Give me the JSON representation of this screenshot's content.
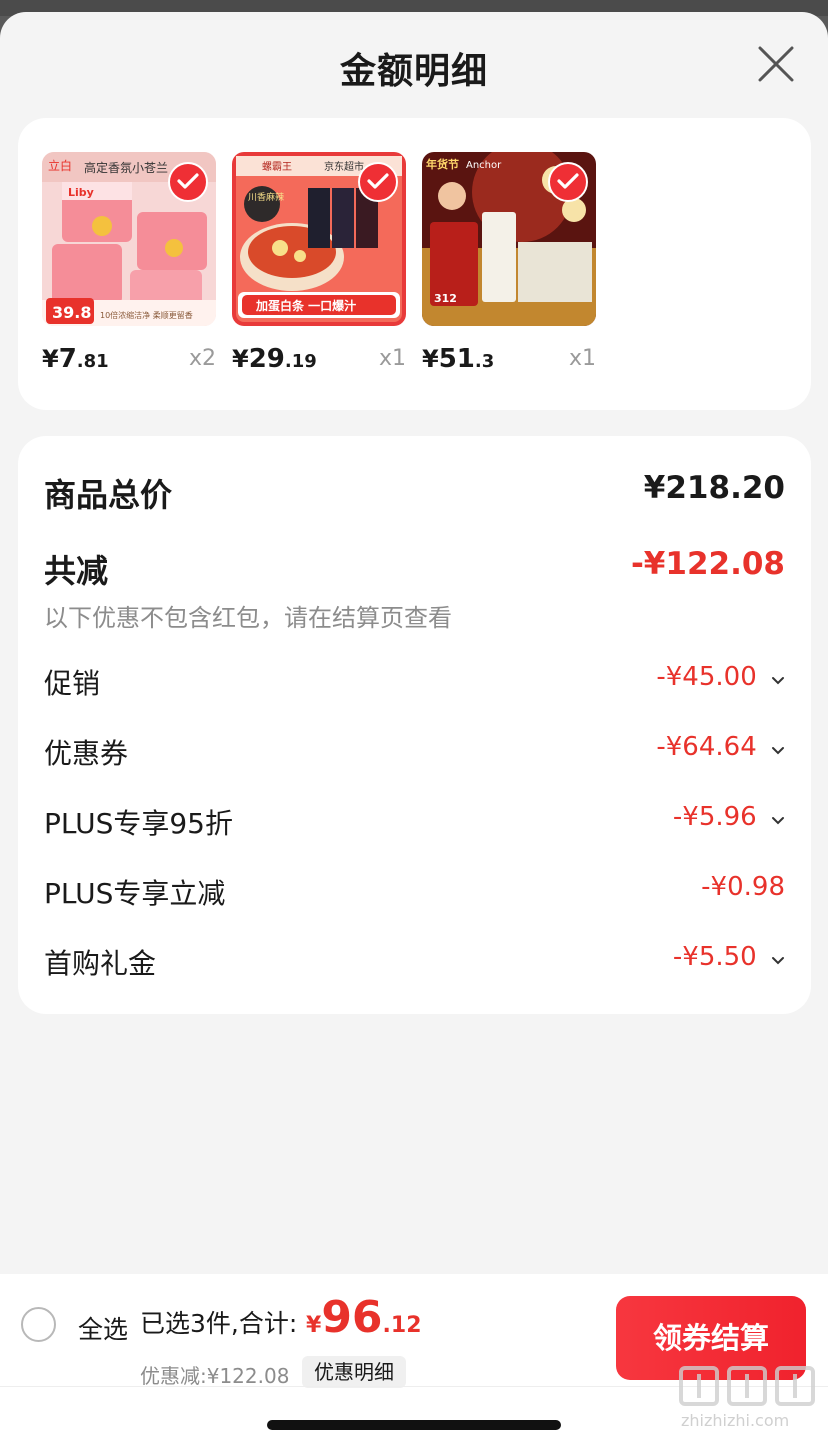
{
  "header": {
    "title": "金额明细",
    "close_icon": "close-icon"
  },
  "products": [
    {
      "name": "product-liby",
      "price_symbol": "¥",
      "price_int": "7",
      "price_dec": ".81",
      "qty": "x2",
      "thumb": {
        "banner": "高定香氛小苍兰",
        "brand": "Liby",
        "promo": "39.8",
        "badge": "10倍浓缩洁净 柔顺更留香"
      }
    },
    {
      "name": "product-luosifen",
      "price_symbol": "¥",
      "price_int": "29",
      "price_dec": ".19",
      "qty": "x1",
      "thumb": {
        "brand": "螺霸王",
        "store": "京东超市",
        "tag": "川香麻辣",
        "badge": "加蛋白条 一口爆汁"
      }
    },
    {
      "name": "product-anchor",
      "price_symbol": "¥",
      "price_int": "51",
      "price_dec": ".3",
      "qty": "x1",
      "thumb": {
        "banner": "年货节",
        "brand": "Anchor",
        "promo": "312"
      }
    }
  ],
  "summary": {
    "total_label": "商品总价",
    "total_value": "¥218.20",
    "discount_label": "共减",
    "discount_value": "-¥122.08",
    "note": "以下优惠不包含红包，请在结算页查看",
    "lines": [
      {
        "label": "促销",
        "value": "-¥45.00",
        "expandable": true
      },
      {
        "label": "优惠券",
        "value": "-¥64.64",
        "expandable": true
      },
      {
        "label": "PLUS专享95折",
        "value": "-¥5.96",
        "expandable": true
      },
      {
        "label": "PLUS专享立减",
        "value": "-¥0.98",
        "expandable": false
      },
      {
        "label": "首购礼金",
        "value": "-¥5.50",
        "expandable": true
      }
    ]
  },
  "bottom_bar": {
    "select_all": "全选",
    "selected_text": "已选3件,合计:",
    "total_symbol": "¥",
    "total_int": "96",
    "total_dec": ".12",
    "discount_text": "优惠减:¥122.08",
    "detail_link": "优惠明细",
    "checkout_button": "领券结算"
  },
  "colors": {
    "accent_red": "#e8322b",
    "button_red": "#f0222d",
    "background": "#f4f4f4"
  },
  "watermark": "zhizhizhi.com"
}
